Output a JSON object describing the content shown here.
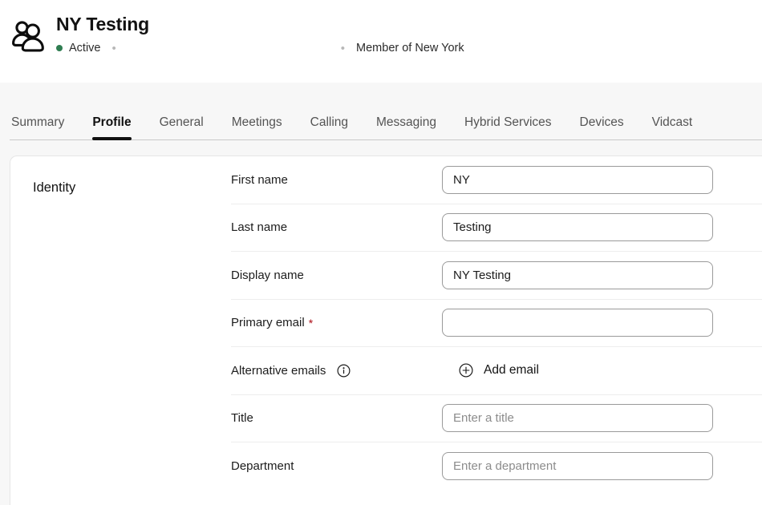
{
  "header": {
    "avatar_icon": "people-group-icon",
    "title": "NY Testing",
    "status": {
      "label": "Active",
      "dot_color": "#2f7d51"
    },
    "separator": "•",
    "ghost_text": "",
    "membership": "Member of New York"
  },
  "tabs": [
    {
      "label": "Summary",
      "active": false
    },
    {
      "label": "Profile",
      "active": true
    },
    {
      "label": "General",
      "active": false
    },
    {
      "label": "Meetings",
      "active": false
    },
    {
      "label": "Calling",
      "active": false
    },
    {
      "label": "Messaging",
      "active": false
    },
    {
      "label": "Hybrid Services",
      "active": false
    },
    {
      "label": "Devices",
      "active": false
    },
    {
      "label": "Vidcast",
      "active": false
    }
  ],
  "identity": {
    "section_label": "Identity",
    "required_marker": "*",
    "rows": [
      {
        "label": "First name",
        "value": "NY",
        "placeholder": ""
      },
      {
        "label": "Last name",
        "value": "Testing",
        "placeholder": ""
      },
      {
        "label": "Display name",
        "value": "NY Testing",
        "placeholder": ""
      },
      {
        "label": "Primary email",
        "value": "",
        "placeholder": "",
        "required": true
      },
      {
        "label": "Alternative emails",
        "info_icon": "info-circle-icon",
        "action_label": "Add email",
        "action_icon": "plus-circle-icon"
      },
      {
        "label": "Title",
        "value": "",
        "placeholder": "Enter a title"
      },
      {
        "label": "Department",
        "value": "",
        "placeholder": "Enter a department"
      }
    ]
  },
  "colors": {
    "accent_active": "#111111",
    "required": "#ab0a15",
    "status_green": "#2f7d51",
    "page_bg": "#f7f7f7"
  }
}
